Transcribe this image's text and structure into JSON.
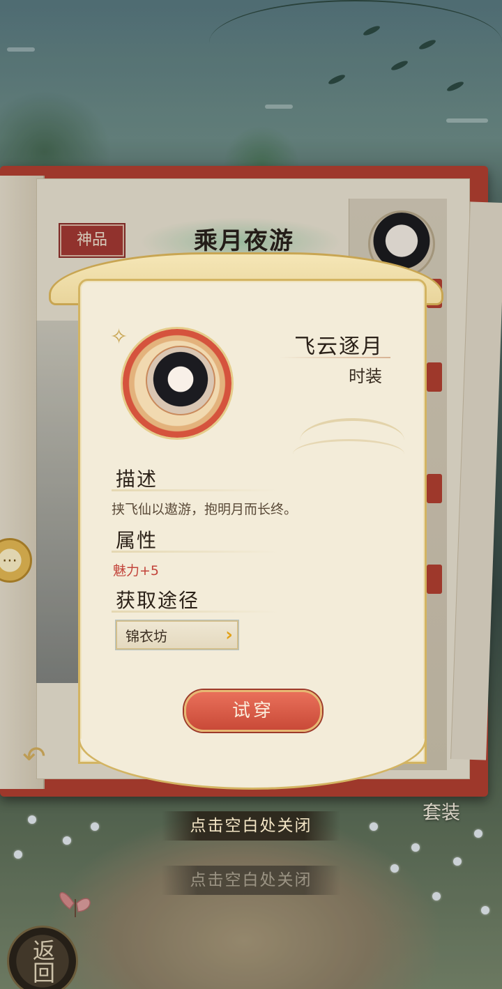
{
  "book": {
    "grade_badge": "神品",
    "outfit_title": "乘月夜游",
    "suit_label": "套装"
  },
  "card": {
    "item_name": "飞云逐月",
    "item_type": "时装",
    "description_title": "描述",
    "description_text": "挟飞仙以遨游，抱明月而长终。",
    "attribute_title": "属性",
    "attribute_text": "魅力+5",
    "source_title": "获取途径",
    "source_label": "锦衣坊",
    "try_on_label": "试穿"
  },
  "hints": {
    "close_hint": "点击空白处关闭",
    "close_hint_background": "点击空白处关闭"
  },
  "nav": {
    "return_label": "返回"
  },
  "colors": {
    "book_red": "#b44032",
    "card_bg": "#f3ecd9",
    "card_border": "#d3b462",
    "attribute_red": "#c2433a",
    "try_on_red": "#c94a38",
    "chevron_gold": "#e2a21a"
  },
  "icons": [
    "chat-bubble-icon",
    "back-arrow-icon",
    "chevron-right-icon",
    "portrait-avatar",
    "butterfly-icon"
  ]
}
